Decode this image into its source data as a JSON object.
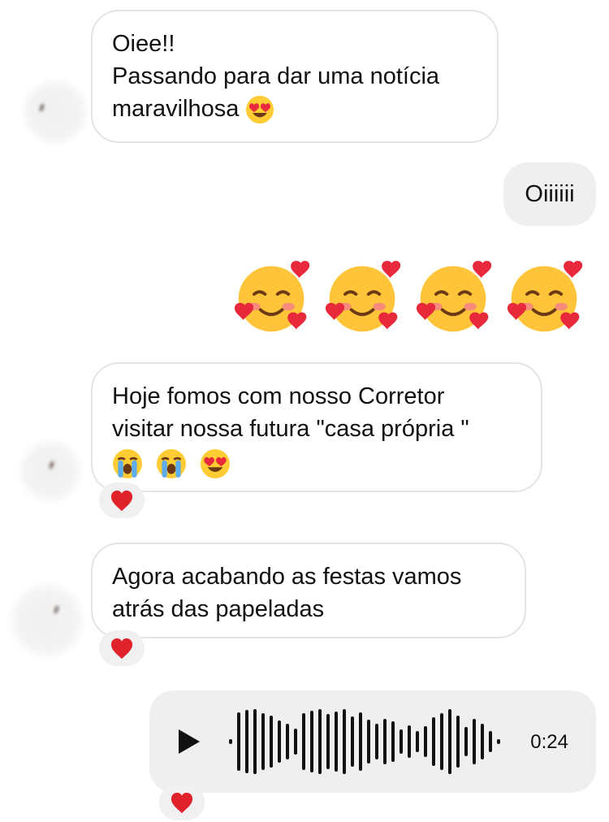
{
  "messages": [
    {
      "id": "m1",
      "direction": "incoming",
      "lines": [
        "Oiee!!",
        "Passando para dar uma notícia",
        "maravilhosa"
      ],
      "trailing_emoji": "heart-eyes"
    },
    {
      "id": "m2",
      "direction": "outgoing",
      "text": "Oiiiiii"
    },
    {
      "id": "m3",
      "direction": "outgoing",
      "emojis": [
        "smiling-face-with-hearts",
        "smiling-face-with-hearts",
        "smiling-face-with-hearts",
        "smiling-face-with-hearts"
      ]
    },
    {
      "id": "m4",
      "direction": "incoming",
      "lines": [
        "Hoje fomos com nosso Corretor",
        "visitar nossa futura \"casa própria \""
      ],
      "emoji_line": [
        "loudly-crying-face",
        "loudly-crying-face",
        "heart-eyes"
      ],
      "reaction": "red-heart"
    },
    {
      "id": "m5",
      "direction": "incoming",
      "lines": [
        "Agora acabando as festas vamos",
        "atrás das papeladas"
      ],
      "reaction": "red-heart"
    },
    {
      "id": "m6",
      "direction": "outgoing",
      "type": "voice",
      "duration": "0:24",
      "reaction": "red-heart"
    }
  ],
  "colors": {
    "incoming_bg": "#ffffff",
    "incoming_border": "#e4e4e4",
    "outgoing_bg": "#efefef",
    "heart": "#e0222b"
  }
}
